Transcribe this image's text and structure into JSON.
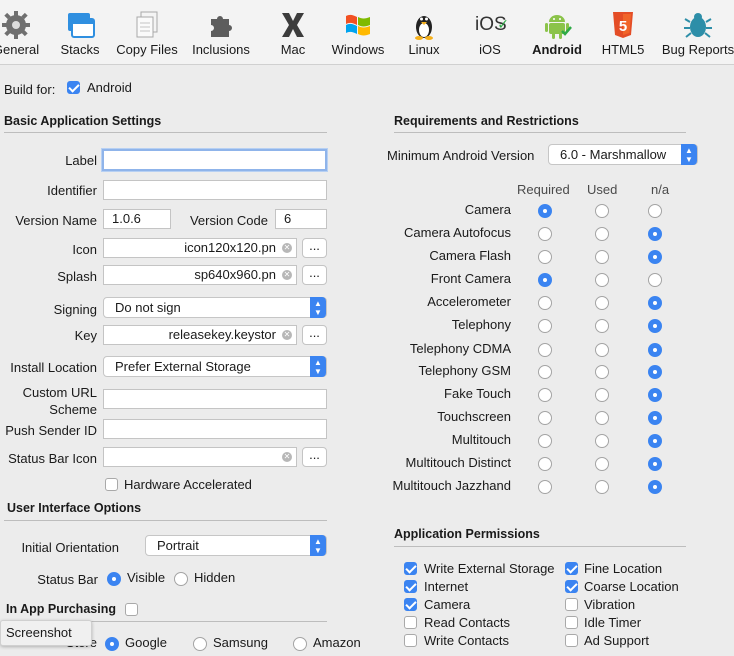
{
  "toolbar": {
    "items": [
      {
        "label": "General",
        "icon": "gear-icon"
      },
      {
        "label": "Stacks",
        "icon": "stacks-icon"
      },
      {
        "label": "Copy Files",
        "icon": "copy-files-icon"
      },
      {
        "label": "Inclusions",
        "icon": "puzzle-icon"
      },
      {
        "label": "Mac",
        "icon": "mac-x-icon"
      },
      {
        "label": "Windows",
        "icon": "windows-icon"
      },
      {
        "label": "Linux",
        "icon": "linux-penguin-icon"
      },
      {
        "label": "iOS",
        "icon": "ios-icon",
        "icon_text": "iOS"
      },
      {
        "label": "Android",
        "icon": "android-icon",
        "active": true
      },
      {
        "label": "HTML5",
        "icon": "html5-icon",
        "icon_text": "5"
      },
      {
        "label": "Bug Reports",
        "icon": "bug-icon"
      }
    ]
  },
  "build_for": {
    "label": "Build for:",
    "value": "Android",
    "checked": true
  },
  "basic": {
    "title": "Basic Application Settings",
    "label_label": "Label",
    "label_value": "",
    "identifier_label": "Identifier",
    "identifier_value": "",
    "version_name_label": "Version Name",
    "version_name_value": "1.0.6",
    "version_code_label": "Version Code",
    "version_code_value": "6",
    "icon_label": "Icon",
    "icon_value": "icon120x120.pn",
    "splash_label": "Splash",
    "splash_value": "sp640x960.pn",
    "signing_label": "Signing",
    "signing_value": "Do not sign",
    "key_label": "Key",
    "key_value": "releasekey.keystor",
    "install_location_label": "Install Location",
    "install_location_value": "Prefer External Storage",
    "custom_url_label_1": "Custom URL",
    "custom_url_label_2": "Scheme",
    "custom_url_value": "",
    "push_sender_label": "Push Sender ID",
    "push_sender_value": "",
    "status_bar_icon_label": "Status Bar Icon",
    "status_bar_icon_value": "",
    "hardware_accelerated_label": "Hardware Accelerated",
    "hardware_accelerated_checked": false,
    "browse_label": "..."
  },
  "ui_options": {
    "title": "User Interface Options",
    "orientation_label": "Initial Orientation",
    "orientation_value": "Portrait",
    "status_bar_label": "Status Bar",
    "status_bar_options": [
      {
        "label": "Visible",
        "selected": true
      },
      {
        "label": "Hidden",
        "selected": false
      }
    ]
  },
  "in_app": {
    "title": "In App Purchasing",
    "checked": false,
    "store_label": "Store",
    "store_options": [
      {
        "label": "Google",
        "selected": true
      },
      {
        "label": "Samsung",
        "selected": false
      },
      {
        "label": "Amazon",
        "selected": false
      }
    ]
  },
  "requirements": {
    "title": "Requirements and Restrictions",
    "min_version_label": "Minimum Android Version",
    "min_version_value": "6.0 - Marshmallow",
    "columns": [
      "Required",
      "Used",
      "n/a"
    ],
    "rows": [
      {
        "label": "Camera",
        "selected": 0
      },
      {
        "label": "Camera Autofocus",
        "selected": 2
      },
      {
        "label": "Camera Flash",
        "selected": 2
      },
      {
        "label": "Front Camera",
        "selected": 0
      },
      {
        "label": "Accelerometer",
        "selected": 2
      },
      {
        "label": "Telephony",
        "selected": 2
      },
      {
        "label": "Telephony CDMA",
        "selected": 2
      },
      {
        "label": "Telephony GSM",
        "selected": 2
      },
      {
        "label": "Fake Touch",
        "selected": 2
      },
      {
        "label": "Touchscreen",
        "selected": 2
      },
      {
        "label": "Multitouch",
        "selected": 2
      },
      {
        "label": "Multitouch Distinct",
        "selected": 2
      },
      {
        "label": "Multitouch Jazzhand",
        "selected": 2
      }
    ]
  },
  "permissions": {
    "title": "Application Permissions",
    "left": [
      {
        "label": "Write External Storage",
        "checked": true
      },
      {
        "label": "Internet",
        "checked": true
      },
      {
        "label": "Camera",
        "checked": true
      },
      {
        "label": "Read Contacts",
        "checked": false
      },
      {
        "label": "Write Contacts",
        "checked": false
      }
    ],
    "right": [
      {
        "label": "Fine Location",
        "checked": true
      },
      {
        "label": "Coarse Location",
        "checked": true
      },
      {
        "label": "Vibration",
        "checked": false
      },
      {
        "label": "Idle Timer",
        "checked": false
      },
      {
        "label": "Ad Support",
        "checked": false
      }
    ]
  },
  "tooltip": {
    "text": "Screenshot"
  },
  "colors": {
    "accent": "#3b84f1",
    "android_green": "#8bc34a",
    "html5_orange": "#e44d26"
  }
}
